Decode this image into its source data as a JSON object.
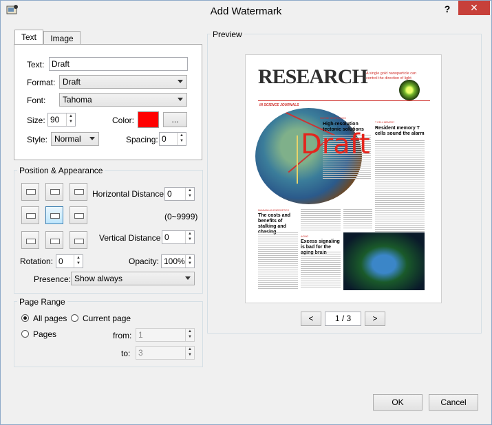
{
  "window": {
    "title": "Add Watermark",
    "help_label": "?",
    "close_label": "✕"
  },
  "tabs": [
    {
      "label": "Text",
      "active": true
    },
    {
      "label": "Image",
      "active": false
    }
  ],
  "text_tab": {
    "text_label": "Text:",
    "text_value": "Draft",
    "format_label": "Format:",
    "format_value": "Draft",
    "font_label": "Font:",
    "font_value": "Tahoma",
    "size_label": "Size:",
    "size_value": "90",
    "color_label": "Color:",
    "color_value": "#ff0000",
    "color_more_label": "...",
    "style_label": "Style:",
    "style_value": "Normal",
    "spacing_label": "Spacing:",
    "spacing_value": "0"
  },
  "position": {
    "group_label": "Position & Appearance",
    "horizontal_label": "Horizontal Distance :",
    "horizontal_value": "0",
    "range_hint": "(0~9999)",
    "vertical_label": "Vertical Distance :",
    "vertical_value": "0",
    "rotation_label": "Rotation:",
    "rotation_value": "0",
    "opacity_label": "Opacity:",
    "opacity_value": "100%",
    "presence_label": "Presence:",
    "presence_value": "Show always",
    "selected_cell": 4
  },
  "page_range": {
    "group_label": "Page Range",
    "all_pages_label": "All pages",
    "current_page_label": "Current page",
    "pages_label": "Pages",
    "from_label": "from:",
    "from_value": "1",
    "to_label": "to:",
    "to_value": "3",
    "selected": "all"
  },
  "preview": {
    "group_label": "Preview",
    "watermark_text": "Draft",
    "prev_label": "<",
    "page_indicator": "1 / 3",
    "next_label": ">",
    "doc": {
      "masthead": "RESEARCH",
      "tagline": "A single gold nanoparticle can control the direction of light",
      "section": "IN SCIENCE JOURNALS",
      "headline1": "High-resolution tectonic solutions",
      "headline2": "Resident memory T cells sound the alarm",
      "headline3": "The costs and benefits of stalking and chasing",
      "headline4": "Excess signaling is bad for the aging brain",
      "kicker1": "MARINE GEOPHYSICS",
      "kicker2": "T CELL MEMORY",
      "kicker3": "MAMMALIAN ENERGETICS",
      "kicker4": "AGING"
    }
  },
  "buttons": {
    "ok_label": "OK",
    "cancel_label": "Cancel"
  },
  "colors": {
    "watermark": "#e4251d",
    "accent_red": "#d0312d"
  }
}
